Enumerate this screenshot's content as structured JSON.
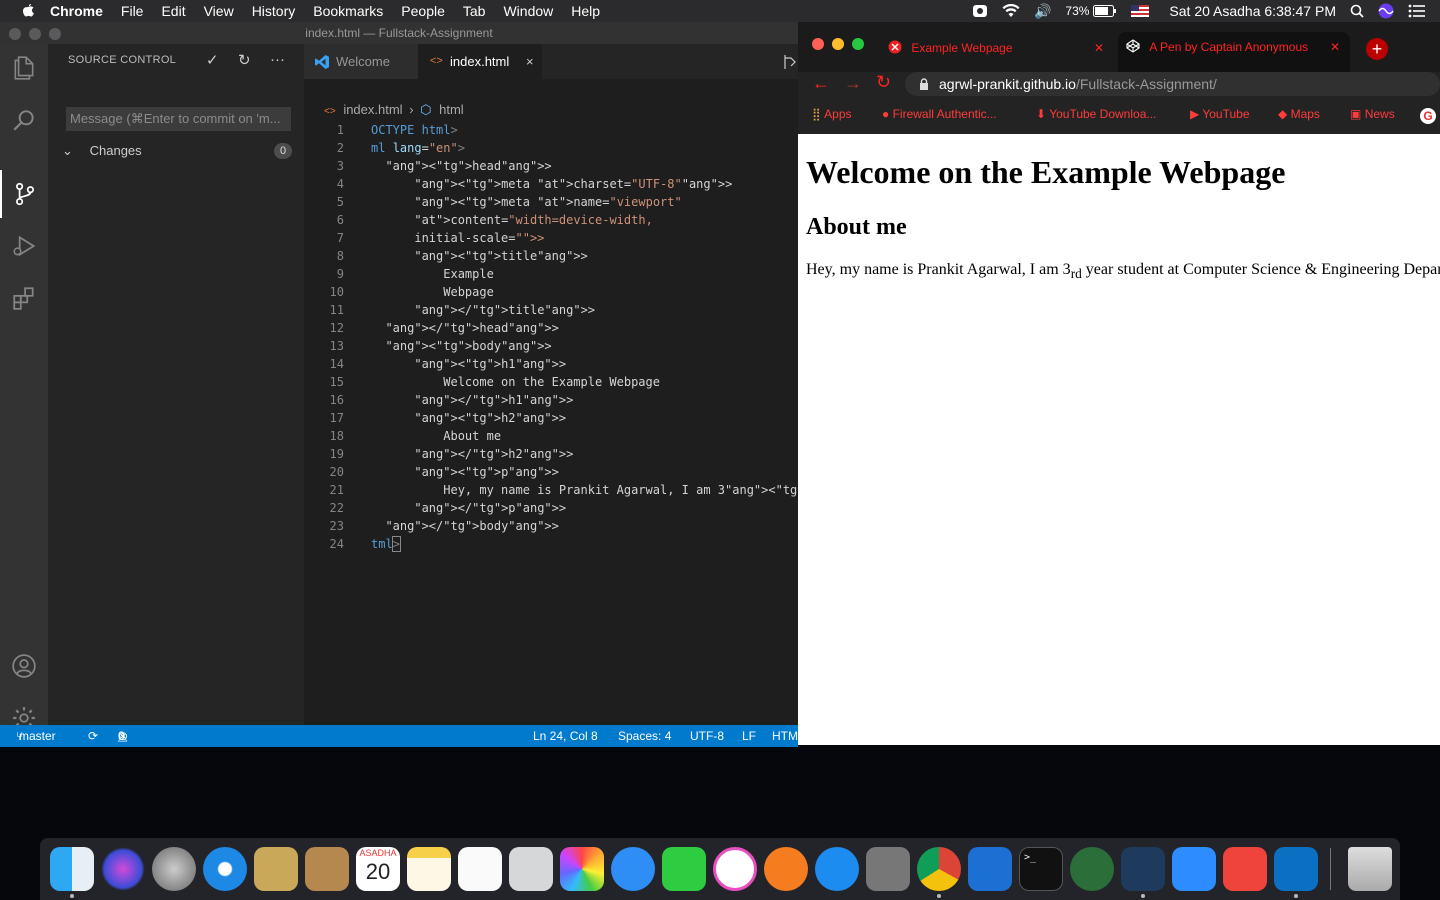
{
  "menubar": {
    "app": "Chrome",
    "items": [
      "File",
      "Edit",
      "View",
      "History",
      "Bookmarks",
      "People",
      "Tab",
      "Window",
      "Help"
    ],
    "battery": "73%",
    "datetime": "Sat 20 Asadha  6:38:47 PM"
  },
  "vscode": {
    "title": "index.html — Fullstack-Assignment",
    "sidebar_title": "SOURCE CONTROL",
    "commit_placeholder": "Message (⌘Enter to commit on 'm...",
    "changes_label": "Changes",
    "changes_count": "0",
    "tabs": [
      {
        "label": "Welcome"
      },
      {
        "label": "index.html"
      }
    ],
    "breadcrumb": {
      "file": "index.html",
      "symbol": "html"
    },
    "code": [
      {
        "n": "1",
        "t": "OCTYPE html>"
      },
      {
        "n": "2",
        "t": "ml lang=\"en\">"
      },
      {
        "n": "3",
        "t": "  <head>"
      },
      {
        "n": "4",
        "t": "      <meta charset=\"UTF-8\">"
      },
      {
        "n": "5",
        "t": "      <meta name=\"viewport\""
      },
      {
        "n": "6",
        "t": "      content=\"width=device-width,"
      },
      {
        "n": "7",
        "t": "      initial-scale=\">"
      },
      {
        "n": "8",
        "t": "      <title>"
      },
      {
        "n": "9",
        "t": "          Example"
      },
      {
        "n": "10",
        "t": "          Webpage"
      },
      {
        "n": "11",
        "t": "      </title>"
      },
      {
        "n": "12",
        "t": "  </head>"
      },
      {
        "n": "13",
        "t": "  <body>"
      },
      {
        "n": "14",
        "t": "      <h1>"
      },
      {
        "n": "15",
        "t": "          Welcome on the Example Webpage"
      },
      {
        "n": "16",
        "t": "      </h1>"
      },
      {
        "n": "17",
        "t": "      <h2>"
      },
      {
        "n": "18",
        "t": "          About me"
      },
      {
        "n": "19",
        "t": "      </h2>"
      },
      {
        "n": "20",
        "t": "      <p>"
      },
      {
        "n": "21",
        "t": "          Hey, my name is Prankit Agarwal, I am 3<sub>rd</su"
      },
      {
        "n": "22",
        "t": "      </p>"
      },
      {
        "n": "23",
        "t": "  </body>"
      },
      {
        "n": "24",
        "t": "tml>"
      }
    ],
    "status": {
      "branch": "master",
      "errors": "0",
      "warnings": "0",
      "position": "Ln 24, Col 8",
      "spaces": "Spaces: 4",
      "encoding": "UTF-8",
      "eol": "LF",
      "language": "HTM"
    }
  },
  "chrome": {
    "tabs": [
      {
        "label": "Example Webpage"
      },
      {
        "label": "A Pen by Captain Anonymous"
      }
    ],
    "url_domain": "agrwl-prankit.github.io",
    "url_path": "/Fullstack-Assignment/",
    "bookmarks": [
      "Apps",
      "Firewall Authentic...",
      "YouTube Downloa...",
      "YouTube",
      "Maps",
      "News"
    ],
    "page": {
      "h1": "Welcome on the Example Webpage",
      "h2": "About me",
      "p_before": "Hey, my name is Prankit Agarwal, I am 3",
      "p_sub": "rd",
      "p_after": " year student at Computer Science & Engineering Depar"
    }
  },
  "dock": {
    "calendar_month": "ASADHA",
    "calendar_day": "20"
  }
}
